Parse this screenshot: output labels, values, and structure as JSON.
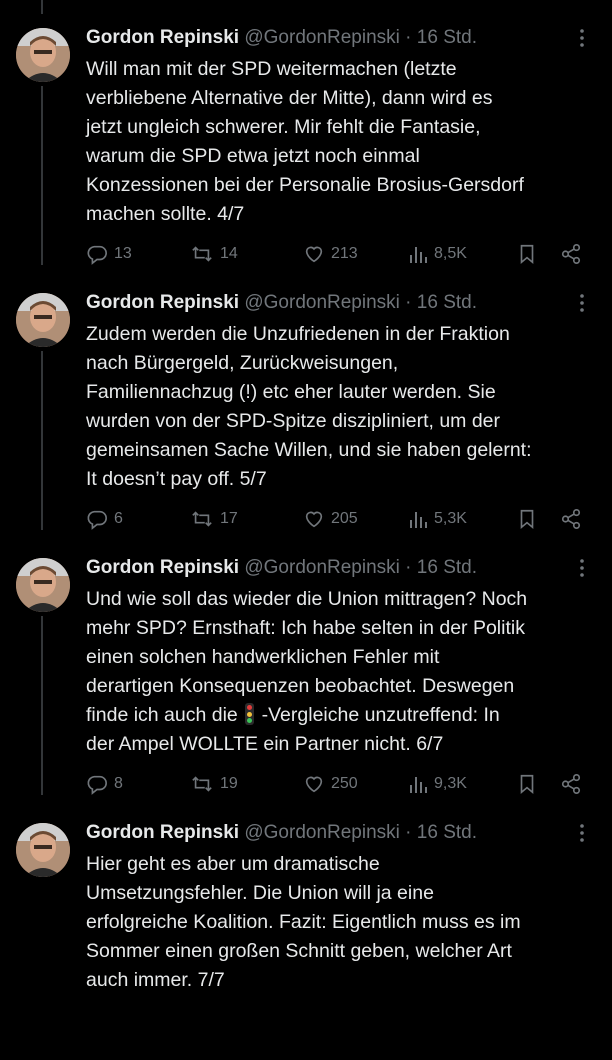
{
  "tweets": [
    {
      "name": "Gordon Repinski",
      "handle": "@GordonRepinski",
      "sep": "·",
      "time": "16 Std.",
      "lines": [
        "Will man mit der SPD weitermachen (letzte",
        "verbliebene Alternative der Mitte), dann wird es",
        "jetzt ungleich schwerer. Mir fehlt die Fantasie,",
        "warum die SPD etwa jetzt noch einmal",
        "Konzessionen bei der Personalie Brosius-Gersdorf",
        "machen sollte. 4/7"
      ],
      "replies": "13",
      "retweets": "14",
      "likes": "213",
      "views": "8,5K"
    },
    {
      "name": "Gordon Repinski",
      "handle": "@GordonRepinski",
      "sep": "·",
      "time": "16 Std.",
      "lines": [
        "Zudem werden die Unzufriedenen in der Fraktion",
        "nach Bürgergeld, Zurückweisungen,",
        "Familiennachzug (!) etc eher lauter werden. Sie",
        "wurden von der SPD-Spitze diszipliniert, um der",
        "gemeinsamen Sache Willen, und sie haben gelernt:",
        "It doesn’t pay off. 5/7"
      ],
      "replies": "6",
      "retweets": "17",
      "likes": "205",
      "views": "5,3K"
    },
    {
      "name": "Gordon Repinski",
      "handle": "@GordonRepinski",
      "sep": "·",
      "time": "16 Std.",
      "lines": [
        "Und wie soll das wieder die Union mittragen? Noch",
        "mehr SPD? Ernsthaft: Ich habe selten in der Politik",
        "einen solchen handwerklichen Fehler mit",
        "derartigen Konsequenzen beobachtet. Deswegen",
        "finde ich auch die",
        "-Vergleiche unzutreffend: In",
        "der Ampel WOLLTE ein Partner nicht. 6/7"
      ],
      "emoji": "traffic-light-emoji",
      "replies": "8",
      "retweets": "19",
      "likes": "250",
      "views": "9,3K"
    },
    {
      "name": "Gordon Repinski",
      "handle": "@GordonRepinski",
      "sep": "·",
      "time": "16 Std.",
      "lines": [
        "Hier geht es aber um dramatische",
        "Umsetzungsfehler. Die Union will ja eine",
        "erfolgreiche Koalition. Fazit: Eigentlich muss es im",
        "Sommer einen großen Schnitt geben, welcher Art",
        "auch immer. 7/7"
      ]
    }
  ],
  "colors": {
    "background": "#000000",
    "text": "#e7e9ea",
    "secondary": "#71767b",
    "thread_line": "#333639"
  },
  "icons": [
    "reply-icon",
    "retweet-icon",
    "like-icon",
    "views-icon",
    "bookmark-icon",
    "share-icon",
    "more-icon"
  ]
}
